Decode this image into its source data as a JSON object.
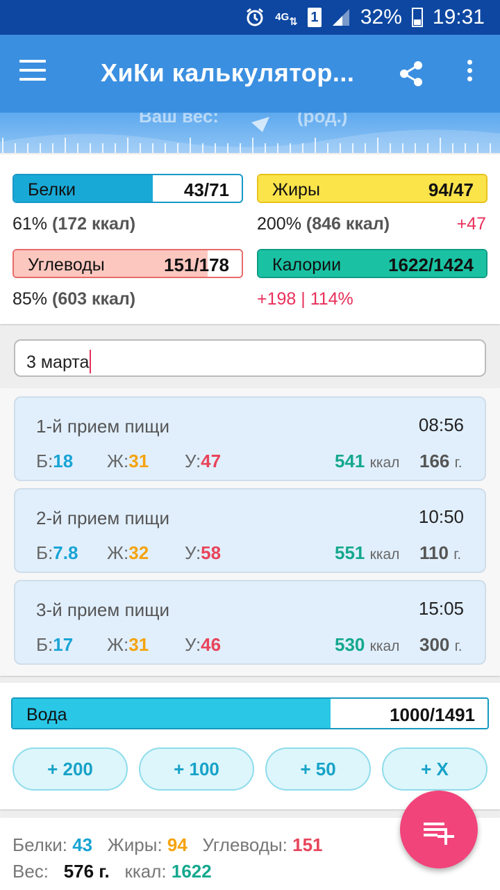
{
  "status_bar": {
    "network": "4G",
    "sim": "1",
    "battery": "32%",
    "time": "19:31"
  },
  "app_bar": {
    "title": "ХиКи калькулятор..."
  },
  "banner": {
    "left_faded": "Ваш вес:",
    "right_faded": "(род.)"
  },
  "macros": {
    "protein": {
      "label": "Белки",
      "value": "43/71",
      "percent_text": "61%",
      "kcal_text": "(172 ккал)",
      "fill_fraction": 0.61
    },
    "fat": {
      "label": "Жиры",
      "value": "94/47",
      "percent_text": "200%",
      "kcal_text": "(846 ккал)",
      "excess": "+47",
      "fill_fraction": 1.0
    },
    "carbs": {
      "label": "Углеводы",
      "value": "151/178",
      "percent_text": "85%",
      "kcal_text": "(603 ккал)",
      "fill_fraction": 0.85
    },
    "calories": {
      "label": "Калории",
      "value": "1622/1424",
      "excess_text": "+198 | 114%",
      "fill_fraction": 1.0
    }
  },
  "date_field": {
    "value": "3 марта"
  },
  "macro_prefixes": {
    "protein": "Б:",
    "fat": "Ж:",
    "carbs": "У:"
  },
  "units": {
    "kcal": "ккал",
    "grams": "г."
  },
  "meals": [
    {
      "name": "1-й прием пищи",
      "time": "08:56",
      "protein": "18",
      "fat": "31",
      "carbs": "47",
      "kcal": "541",
      "weight": "166"
    },
    {
      "name": "2-й прием пищи",
      "time": "10:50",
      "protein": "7.8",
      "fat": "32",
      "carbs": "58",
      "kcal": "551",
      "weight": "110"
    },
    {
      "name": "3-й прием пищи",
      "time": "15:05",
      "protein": "17",
      "fat": "31",
      "carbs": "46",
      "kcal": "530",
      "weight": "300"
    }
  ],
  "water": {
    "label": "Вода",
    "value": "1000/1491",
    "fill_fraction": 0.67,
    "buttons": [
      "+ 200",
      "+ 100",
      "+ 50",
      "+ X"
    ]
  },
  "totals": {
    "protein_label": "Белки:",
    "protein": "43",
    "fat_label": "Жиры:",
    "fat": "94",
    "carbs_label": "Углеводы:",
    "carbs": "151",
    "weight_label": "Вес:",
    "weight": "576 г.",
    "kcal_label": "ккал:",
    "kcal": "1622"
  },
  "colors": {
    "app_bar": "#3b8fe0",
    "status_bar": "#0d47a1",
    "protein": "#19a4d4",
    "fat": "#f5a30f",
    "carbs": "#e8445a",
    "kcal": "#14a88e",
    "fab": "#f1447a"
  }
}
